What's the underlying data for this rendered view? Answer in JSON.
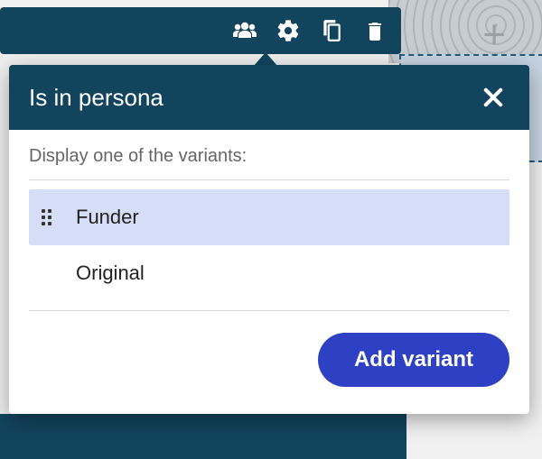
{
  "popover": {
    "title": "Is in persona",
    "instruction": "Display one of the variants:",
    "variants": [
      {
        "label": "Funder",
        "selected": true,
        "draggable": true
      },
      {
        "label": "Original",
        "selected": false,
        "draggable": false
      }
    ],
    "add_button_label": "Add variant"
  },
  "toolbar": {
    "icons": [
      "people-icon",
      "gear-icon",
      "copy-icon",
      "trash-icon"
    ]
  },
  "background": {
    "plus": "+"
  }
}
